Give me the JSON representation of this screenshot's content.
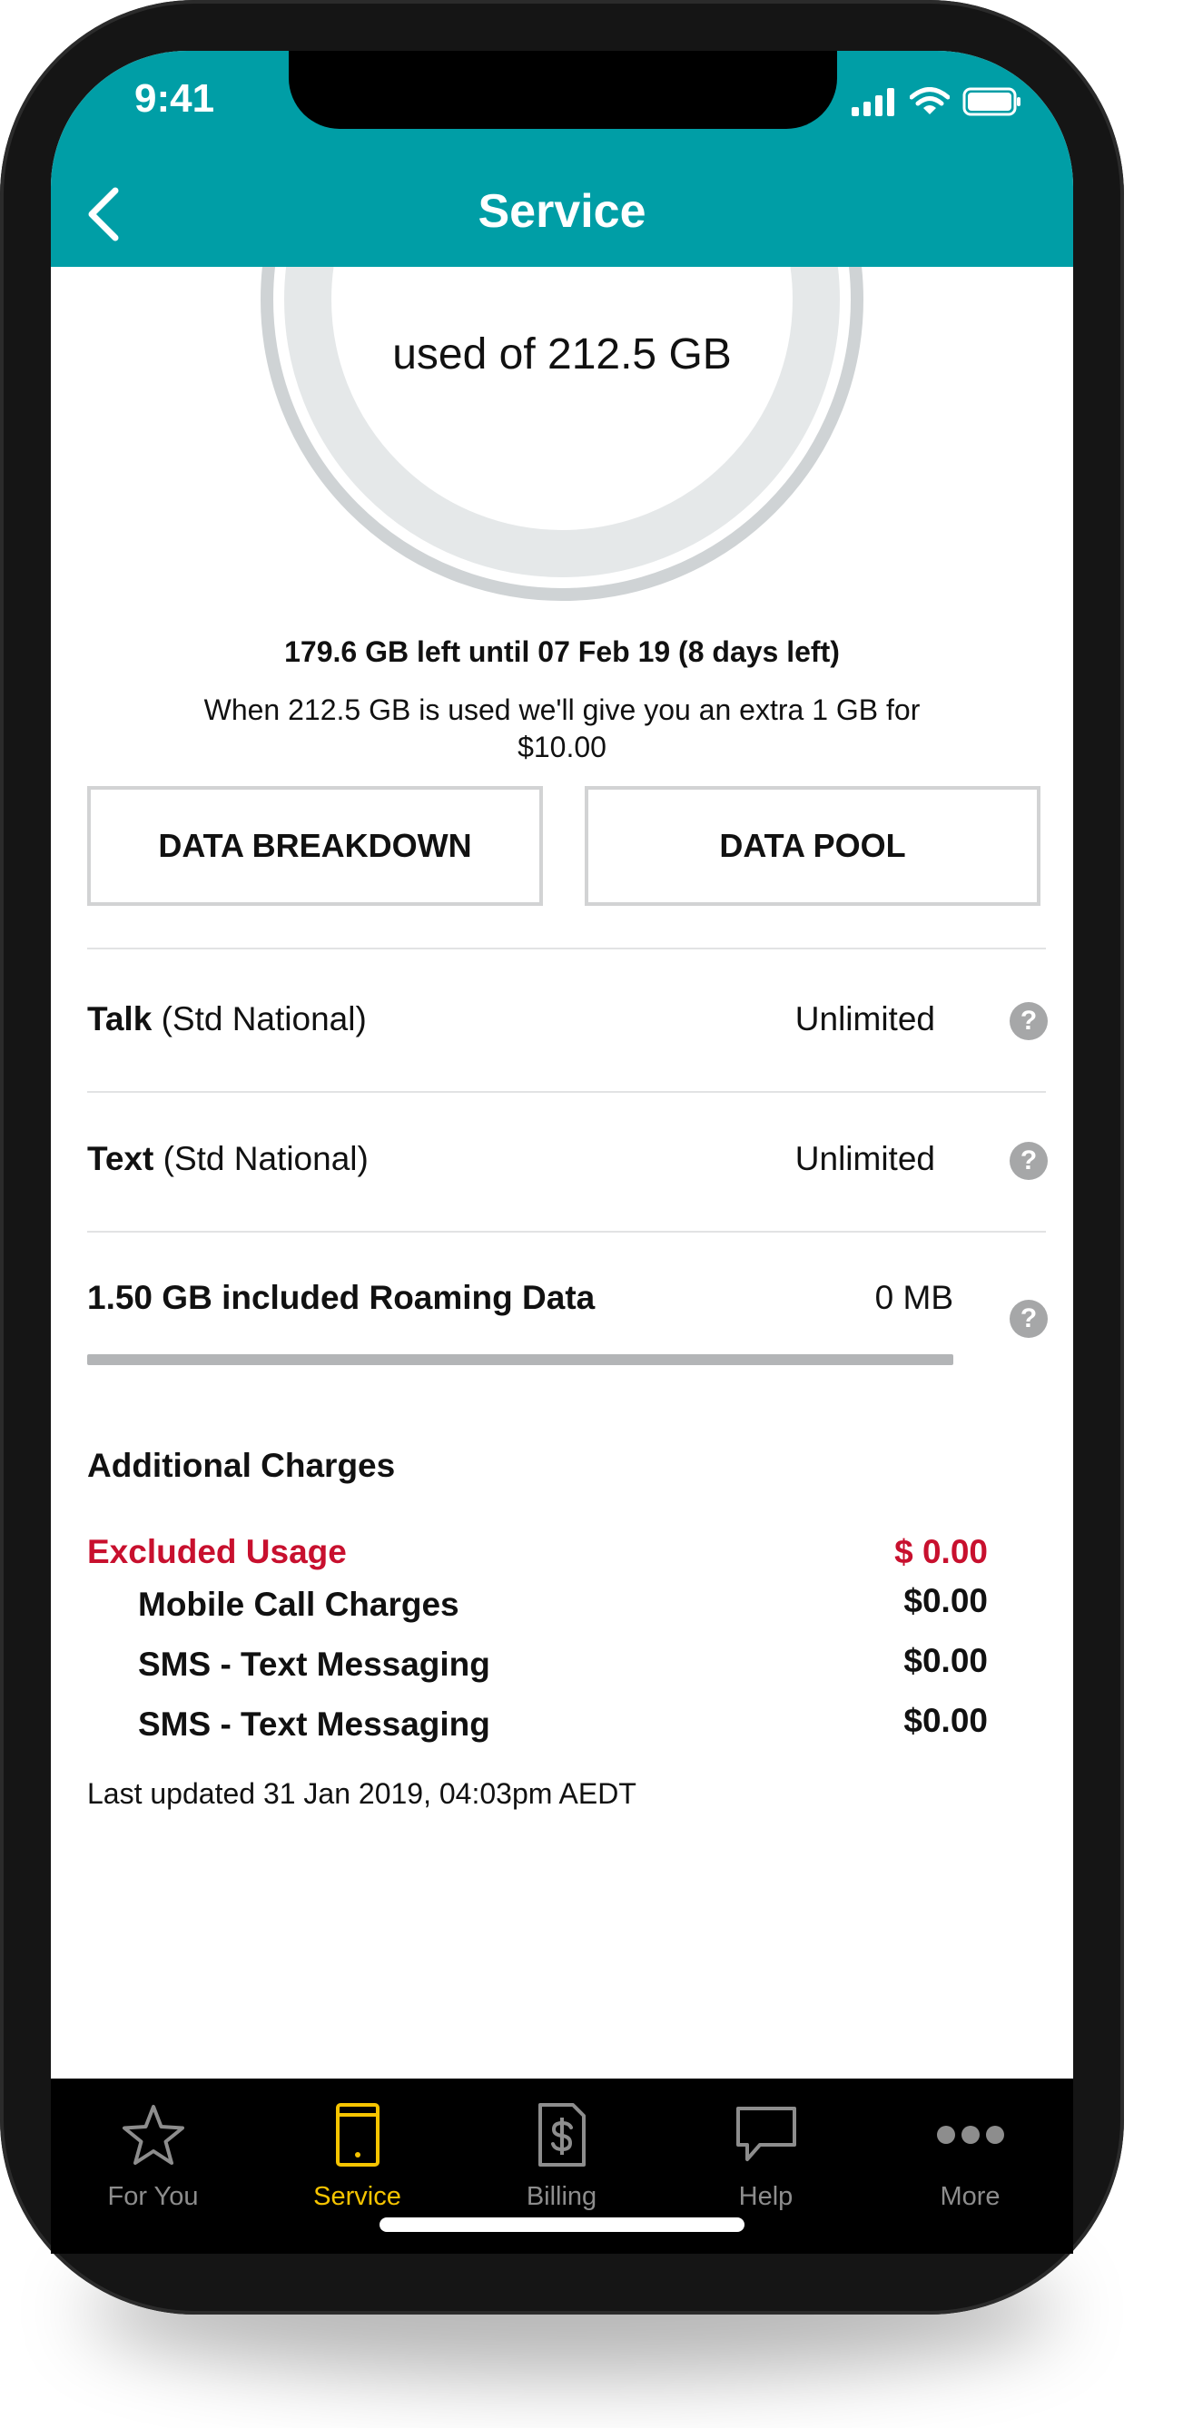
{
  "status_bar": {
    "time": "9:41"
  },
  "header": {
    "title": "Service"
  },
  "usage": {
    "used_label": "used of 212.5 GB",
    "left_label": "179.6 GB left until 07 Feb 19 (8 days left)",
    "extra_label": "When 212.5 GB is used we'll give you an extra 1 GB for $10.00"
  },
  "buttons": {
    "breakdown": "DATA BREAKDOWN",
    "pool": "DATA POOL"
  },
  "rows": [
    {
      "name": "Talk",
      "qualifier": "(Std National)",
      "value": "Unlimited"
    },
    {
      "name": "Text",
      "qualifier": "(Std National)",
      "value": "Unlimited"
    }
  ],
  "roaming": {
    "label": "1.50 GB included Roaming Data",
    "value": "0 MB"
  },
  "additional": {
    "title": "Additional Charges",
    "excluded": {
      "label": "Excluded Usage",
      "value": "$ 0.00"
    },
    "charges": [
      {
        "label": "Mobile Call Charges",
        "value": "$0.00"
      },
      {
        "label": "SMS - Text Messaging",
        "value": "$0.00"
      },
      {
        "label": "SMS - Text Messaging",
        "value": "$0.00"
      }
    ]
  },
  "last_updated": "Last updated 31 Jan 2019, 04:03pm AEDT",
  "help_glyph": "?",
  "tabs": [
    {
      "label": "For You",
      "icon": "star-icon"
    },
    {
      "label": "Service",
      "icon": "phone-icon"
    },
    {
      "label": "Billing",
      "icon": "bill-icon"
    },
    {
      "label": "Help",
      "icon": "chat-bubble-icon"
    },
    {
      "label": "More",
      "icon": "more-dots-icon"
    }
  ],
  "colors": {
    "header": "#009ea6",
    "accent": "#f6c400",
    "alert": "#c8102e"
  }
}
